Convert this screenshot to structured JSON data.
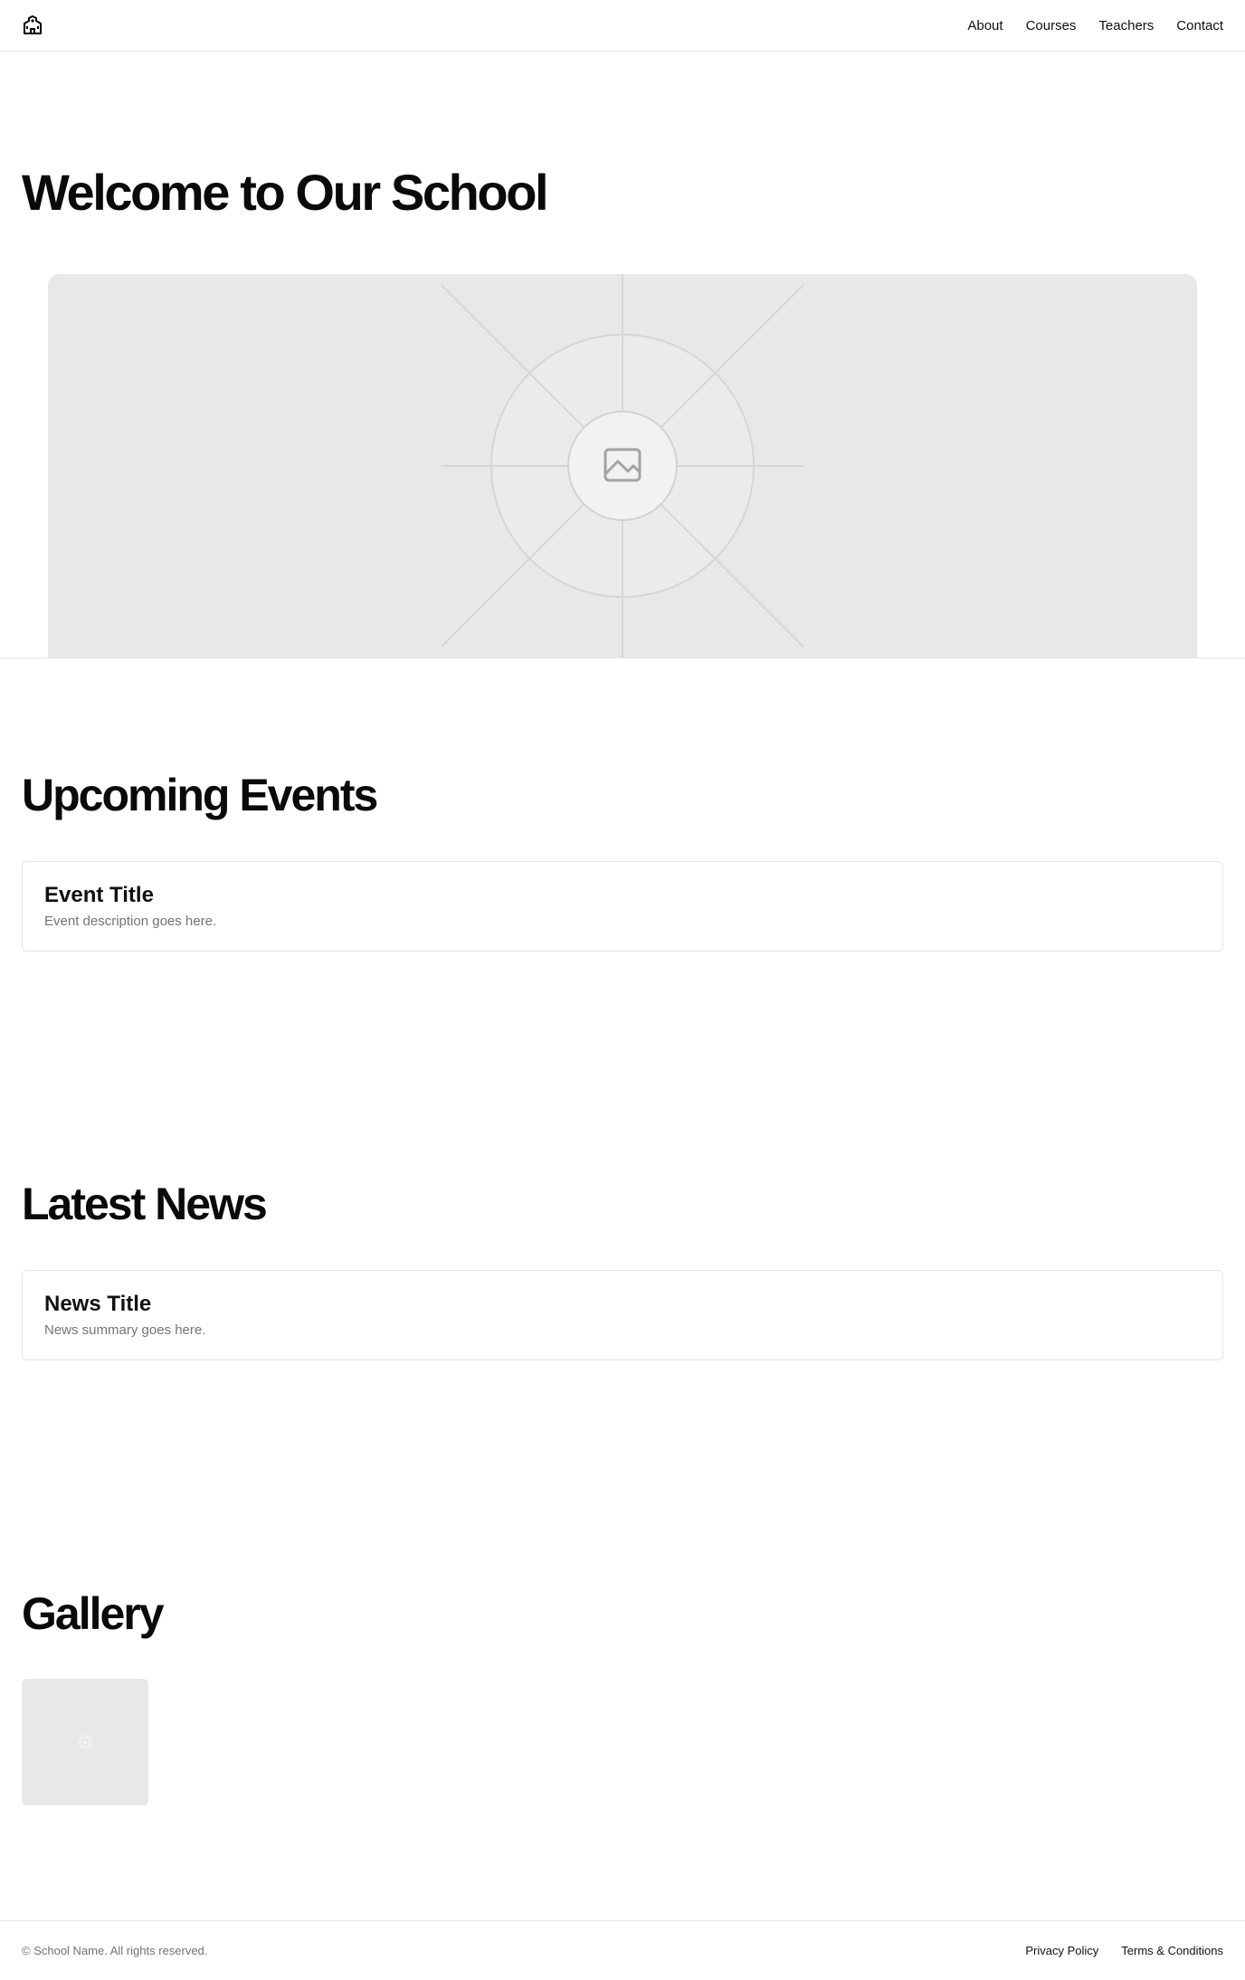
{
  "header": {
    "logo_icon": "school-building-icon",
    "nav": [
      {
        "label": "About"
      },
      {
        "label": "Courses"
      },
      {
        "label": "Teachers"
      },
      {
        "label": "Contact"
      }
    ]
  },
  "hero": {
    "title": "Welcome to Our School",
    "image_icon": "image-placeholder-icon"
  },
  "events": {
    "title": "Upcoming Events",
    "items": [
      {
        "title": "Event Title",
        "description": "Event description goes here."
      }
    ]
  },
  "news": {
    "title": "Latest News",
    "items": [
      {
        "title": "News Title",
        "summary": "News summary goes here."
      }
    ]
  },
  "gallery": {
    "title": "Gallery",
    "items": [
      {
        "icon": "image-placeholder-icon"
      }
    ]
  },
  "footer": {
    "copyright": "© School Name. All rights reserved.",
    "links": [
      {
        "label": "Privacy Policy"
      },
      {
        "label": "Terms & Conditions"
      }
    ]
  },
  "colors": {
    "text": "#0a0a0a",
    "muted": "#737373",
    "border": "#e6e6e6",
    "placeholder": "#e8e8e8"
  }
}
